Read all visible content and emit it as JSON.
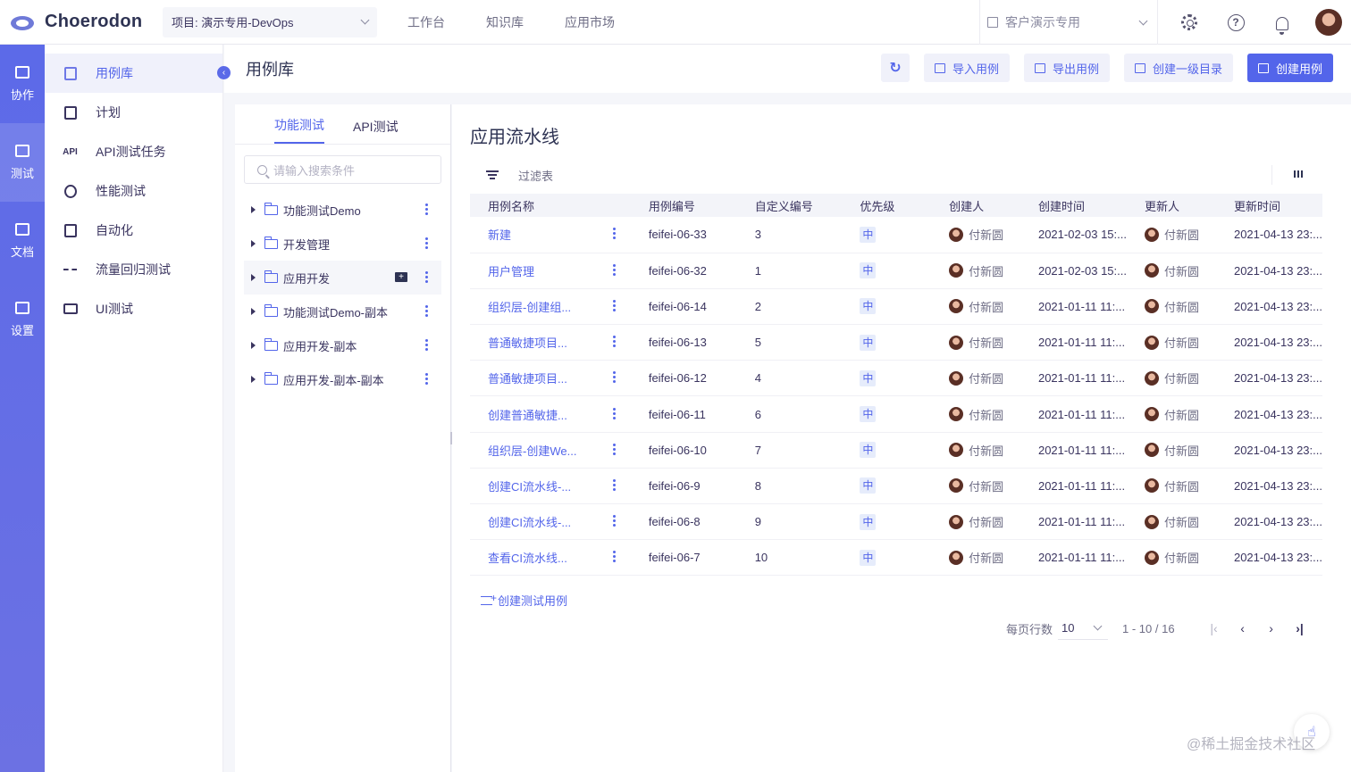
{
  "topbar": {
    "logo_text": "Choerodon",
    "project": "项目: 演示专用-DevOps",
    "nav": [
      "工作台",
      "知识库",
      "应用市场"
    ],
    "org": "客户演示专用"
  },
  "rail": [
    {
      "label": "协作",
      "icon": "collab-icon"
    },
    {
      "label": "测试",
      "icon": "test-icon"
    },
    {
      "label": "文档",
      "icon": "doc-icon"
    },
    {
      "label": "设置",
      "icon": "settings-icon"
    }
  ],
  "menu": [
    {
      "label": "用例库",
      "icon": "case-library-icon"
    },
    {
      "label": "计划",
      "icon": "calendar-icon"
    },
    {
      "label": "API测试任务",
      "icon": "API"
    },
    {
      "label": "性能测试",
      "icon": "performance-icon"
    },
    {
      "label": "自动化",
      "icon": "automation-icon"
    },
    {
      "label": "流量回归测试",
      "icon": "traffic-icon"
    },
    {
      "label": "UI测试",
      "icon": "ui-test-icon"
    }
  ],
  "page": {
    "title": "用例库",
    "buttons": {
      "import": "导入用例",
      "export": "导出用例",
      "create_dir": "创建一级目录",
      "create_case": "创建用例"
    }
  },
  "tree": {
    "tabs": [
      "功能测试",
      "API测试"
    ],
    "search_placeholder": "请输入搜索条件",
    "folders": [
      "功能测试Demo",
      "开发管理",
      "应用开发",
      "功能测试Demo-副本",
      "应用开发-副本",
      "应用开发-副本-副本"
    ]
  },
  "main": {
    "title": "应用流水线",
    "filter_label": "过滤表",
    "columns": [
      "用例名称",
      "用例编号",
      "自定义编号",
      "优先级",
      "创建人",
      "创建时间",
      "更新人",
      "更新时间"
    ],
    "rows": [
      {
        "name": "新建",
        "code": "feifei-06-33",
        "custom": "3",
        "priority": "中",
        "creator": "付新圆",
        "created": "2021-02-03 15:...",
        "updater": "付新圆",
        "updated": "2021-04-13 23:..."
      },
      {
        "name": "用户管理",
        "code": "feifei-06-32",
        "custom": "1",
        "priority": "中",
        "creator": "付新圆",
        "created": "2021-02-03 15:...",
        "updater": "付新圆",
        "updated": "2021-04-13 23:..."
      },
      {
        "name": "组织层-创建组...",
        "code": "feifei-06-14",
        "custom": "2",
        "priority": "中",
        "creator": "付新圆",
        "created": "2021-01-11 11:...",
        "updater": "付新圆",
        "updated": "2021-04-13 23:..."
      },
      {
        "name": "普通敏捷项目...",
        "code": "feifei-06-13",
        "custom": "5",
        "priority": "中",
        "creator": "付新圆",
        "created": "2021-01-11 11:...",
        "updater": "付新圆",
        "updated": "2021-04-13 23:..."
      },
      {
        "name": "普通敏捷项目...",
        "code": "feifei-06-12",
        "custom": "4",
        "priority": "中",
        "creator": "付新圆",
        "created": "2021-01-11 11:...",
        "updater": "付新圆",
        "updated": "2021-04-13 23:..."
      },
      {
        "name": "创建普通敏捷...",
        "code": "feifei-06-11",
        "custom": "6",
        "priority": "中",
        "creator": "付新圆",
        "created": "2021-01-11 11:...",
        "updater": "付新圆",
        "updated": "2021-04-13 23:..."
      },
      {
        "name": "组织层-创建We...",
        "code": "feifei-06-10",
        "custom": "7",
        "priority": "中",
        "creator": "付新圆",
        "created": "2021-01-11 11:...",
        "updater": "付新圆",
        "updated": "2021-04-13 23:..."
      },
      {
        "name": "创建CI流水线-...",
        "code": "feifei-06-9",
        "custom": "8",
        "priority": "中",
        "creator": "付新圆",
        "created": "2021-01-11 11:...",
        "updater": "付新圆",
        "updated": "2021-04-13 23:..."
      },
      {
        "name": "创建CI流水线-...",
        "code": "feifei-06-8",
        "custom": "9",
        "priority": "中",
        "creator": "付新圆",
        "created": "2021-01-11 11:...",
        "updater": "付新圆",
        "updated": "2021-04-13 23:..."
      },
      {
        "name": "查看CI流水线...",
        "code": "feifei-06-7",
        "custom": "10",
        "priority": "中",
        "creator": "付新圆",
        "created": "2021-01-11 11:...",
        "updater": "付新圆",
        "updated": "2021-04-13 23:..."
      }
    ],
    "create_test_case": "创建测试用例",
    "pager": {
      "rows_label": "每页行数",
      "page_size": "10",
      "range": "1 - 10 / 16"
    }
  },
  "watermark": "@稀土掘金技术社区",
  "colors": {
    "primary": "#5365ea",
    "rail": "#5c6ae8"
  }
}
